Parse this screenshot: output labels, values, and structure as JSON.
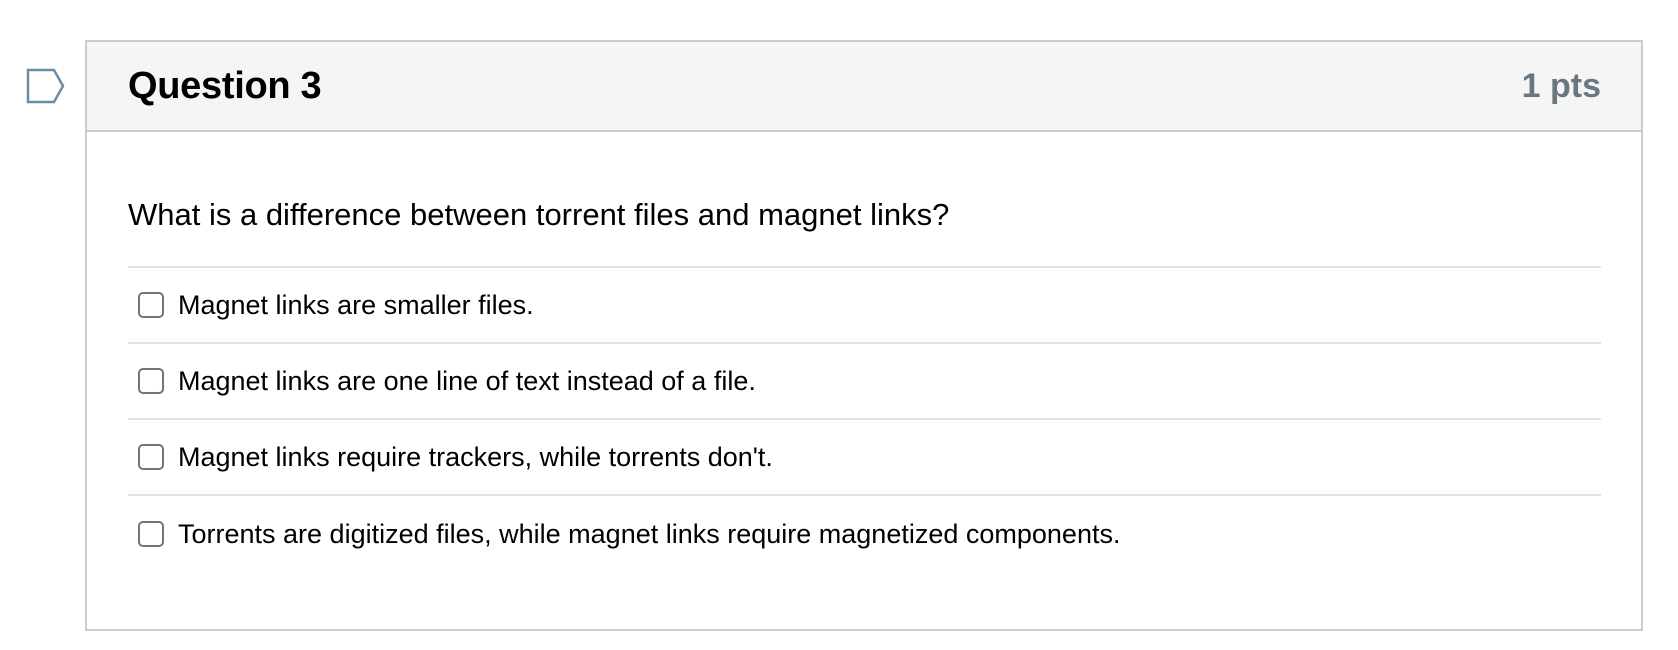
{
  "question": {
    "title": "Question 3",
    "points": "1 pts",
    "text": "What is a difference between torrent files and magnet links?",
    "answers": [
      {
        "label": "Magnet links are smaller files.",
        "checked": false
      },
      {
        "label": "Magnet links are one line of text instead of a file.",
        "checked": false
      },
      {
        "label": "Magnet links require trackers, while torrents don't.",
        "checked": false
      },
      {
        "label": "Torrents are digitized files, while magnet links require magnetized components.",
        "checked": false
      }
    ]
  },
  "flag": {
    "icon": "flag-icon",
    "color": "#6a8da8"
  },
  "colors": {
    "header_background": "#f5f5f5",
    "border": "#c7cdd1",
    "points_text": "#6b7780"
  }
}
